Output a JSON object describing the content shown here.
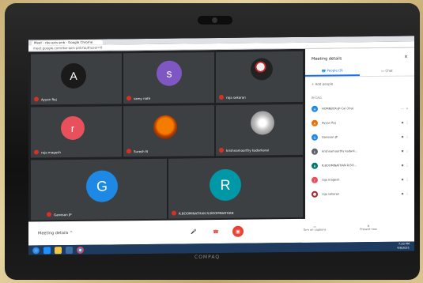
{
  "browser": {
    "tab_title": "Meet - rbe-qxis-pnb - Google Chrome",
    "url": "meet.google.com/rbe-qxis-pnb?authuser=0"
  },
  "tiles": [
    {
      "initial": "A",
      "color": "#1a1a1a",
      "name": "Ayyan Raj"
    },
    {
      "initial": "s",
      "color": "#7e57c2",
      "name": "samy nath"
    },
    {
      "initial": "",
      "color": "#2a2a2a",
      "name": "raja sekaran"
    },
    {
      "initial": "r",
      "color": "#e8505b",
      "name": "raja magesh"
    },
    {
      "initial": "",
      "color": "#1a1a1a",
      "name": "Suresh N"
    },
    {
      "initial": "",
      "color": "#2a2a2a",
      "name": "krishnamoorthy kadarkarai"
    },
    {
      "initial": "G",
      "color": "#1e88e5",
      "name": "Ganesan JP"
    },
    {
      "initial": "R",
      "color": "#0097a7",
      "name": "R.BOOMINATHAN R.BOOMINATHAN"
    }
  ],
  "sidebar": {
    "title": "Meeting details",
    "close_icon": "close-icon",
    "tab_people": "People (9)",
    "tab_chat": "Chat",
    "add_people": "Add people",
    "section_label": "IN CALL",
    "participants": [
      {
        "initial": "H",
        "color": "#1e88e5",
        "name": "HOMNBOX-JP-Cal (You)"
      },
      {
        "initial": "A",
        "color": "#e8710a",
        "name": "Ayyan Raj"
      },
      {
        "initial": "G",
        "color": "#1e88e5",
        "name": "Ganesan JP"
      },
      {
        "initial": "k",
        "color": "#5f6368",
        "name": "krishnamoorthy kadark..."
      },
      {
        "initial": "R",
        "color": "#00796b",
        "name": "R.BOOMINATHAN R.BO..."
      },
      {
        "initial": "r",
        "color": "#e8505b",
        "name": "raja magesh"
      },
      {
        "initial": "",
        "color": "#aaa",
        "name": "raja sekaran"
      }
    ]
  },
  "bottom_bar": {
    "meeting_details": "Meeting details",
    "turn_on_captions": "Turn on captions",
    "present_now": "Present now"
  },
  "taskbar": {
    "time": "7:20 PM",
    "date": "4/8/2021"
  }
}
